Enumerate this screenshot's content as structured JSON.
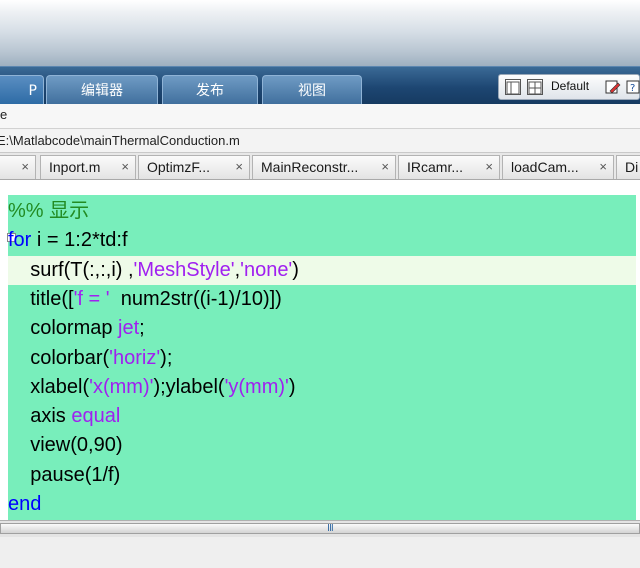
{
  "toolstrip": {
    "tabs": [
      {
        "label": "P"
      },
      {
        "label": "编辑器"
      },
      {
        "label": "发布"
      },
      {
        "label": "视图"
      }
    ],
    "layout_label": "Default"
  },
  "row_label": "e",
  "path": "E:\\Matlabcode\\mainThermalConduction.m",
  "file_tabs": [
    {
      "label": "Inport.m"
    },
    {
      "label": "OptimzF..."
    },
    {
      "label": "MainReconstr..."
    },
    {
      "label": "IRcamr..."
    },
    {
      "label": "loadCam..."
    },
    {
      "label": "Di"
    }
  ],
  "code": {
    "lines": [
      {
        "segments": [
          {
            "t": "%% 显示",
            "c": "cm"
          }
        ]
      },
      {
        "segments": [
          {
            "t": "for",
            "c": "kw"
          },
          {
            "t": " i = 1:2*td:f",
            "c": ""
          }
        ]
      },
      {
        "segments": [
          {
            "t": "    surf(T(:,:,i) ,",
            "c": ""
          },
          {
            "t": "'MeshStyle'",
            "c": "str"
          },
          {
            "t": ",",
            "c": ""
          },
          {
            "t": "'none'",
            "c": "str"
          },
          {
            "t": ")",
            "c": ""
          }
        ]
      },
      {
        "segments": [
          {
            "t": "    title([",
            "c": ""
          },
          {
            "t": "'f = '",
            "c": "str"
          },
          {
            "t": "  num2str((i-1)/10)])",
            "c": ""
          }
        ]
      },
      {
        "segments": [
          {
            "t": "    colormap ",
            "c": ""
          },
          {
            "t": "jet",
            "c": "str"
          },
          {
            "t": ";",
            "c": ""
          }
        ]
      },
      {
        "segments": [
          {
            "t": "    colorbar(",
            "c": ""
          },
          {
            "t": "'horiz'",
            "c": "str"
          },
          {
            "t": ");",
            "c": ""
          }
        ]
      },
      {
        "segments": [
          {
            "t": "    xlabel(",
            "c": ""
          },
          {
            "t": "'x(mm)'",
            "c": "str"
          },
          {
            "t": ");ylabel(",
            "c": ""
          },
          {
            "t": "'y(mm)'",
            "c": "str"
          },
          {
            "t": ")",
            "c": ""
          }
        ]
      },
      {
        "segments": [
          {
            "t": "    axis ",
            "c": ""
          },
          {
            "t": "equal",
            "c": "str"
          }
        ]
      },
      {
        "segments": [
          {
            "t": "    view(0,90)",
            "c": ""
          }
        ]
      },
      {
        "segments": [
          {
            "t": "    pause(1/f)",
            "c": ""
          }
        ]
      },
      {
        "segments": [
          {
            "t": "end",
            "c": "kw"
          }
        ]
      }
    ],
    "highlighted_line": 2,
    "colors": {
      "background": "#78eebb",
      "keyword": "#0000ff",
      "comment": "#228b22",
      "string": "#a020f0",
      "current_line": "#eefbe8"
    }
  },
  "scrollbar_grip": "III"
}
